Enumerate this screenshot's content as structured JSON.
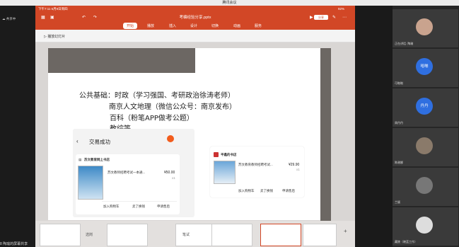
{
  "meeting": {
    "title": "腾讯会议",
    "sharing_label": "共享中",
    "bottom_share": "8 陶瑜的屏幕共享"
  },
  "ppt": {
    "status_time": "下午7:11  6月9日周四",
    "battery": "92%",
    "file_title": "考编经验分享.pptx",
    "tabs": [
      "开始",
      "播放",
      "插入",
      "设计",
      "切换",
      "动画",
      "服务"
    ],
    "active_tab": "开始",
    "share_button": "分享",
    "play_label": "播放幻灯片"
  },
  "slide": {
    "lines": [
      "公共基础：时政（学习强国、考研政治徐涛老师）",
      "南京人文地理（微信公众号：南京发布）",
      "百科（粉笔APP做考公题）",
      "教综等"
    ]
  },
  "popup": {
    "back_icon": "chevron-left-icon",
    "title": "交易成功",
    "shop_name": "苏文教育网上书店",
    "item_title": "苏文教师招聘考试一本通...",
    "item_price": "¥50.00",
    "item_qty": "x1",
    "actions": [
      "加入购物车",
      "卖了换钱",
      "申请售后"
    ]
  },
  "card2": {
    "shop_name": "平鑫的书店",
    "item_title": "苏文教育教师招聘考试...",
    "item_price": "¥29.90",
    "item_qty": "x1",
    "actions": [
      "加入购物车",
      "卖了换钱",
      "申请售后"
    ]
  },
  "thumbs": {
    "labels": [
      "选岗",
      "笔试"
    ]
  },
  "participants": [
    {
      "name": "正在讲话: 陶瑜",
      "avatar": "",
      "color": "#c9a38e"
    },
    {
      "name": "可啪啪",
      "avatar": "哈啪",
      "color": "#2f6fe0"
    },
    {
      "name": "周丹丹",
      "avatar": "丹丹",
      "color": "#2f6fe0"
    },
    {
      "name": "陈谢娜",
      "avatar": "",
      "color": "#8a7a6a"
    },
    {
      "name": "兰颖",
      "avatar": "",
      "color": "#777777"
    },
    {
      "name": "藏陵（晓蓝工作）",
      "avatar": "",
      "color": "#dddddd"
    }
  ]
}
